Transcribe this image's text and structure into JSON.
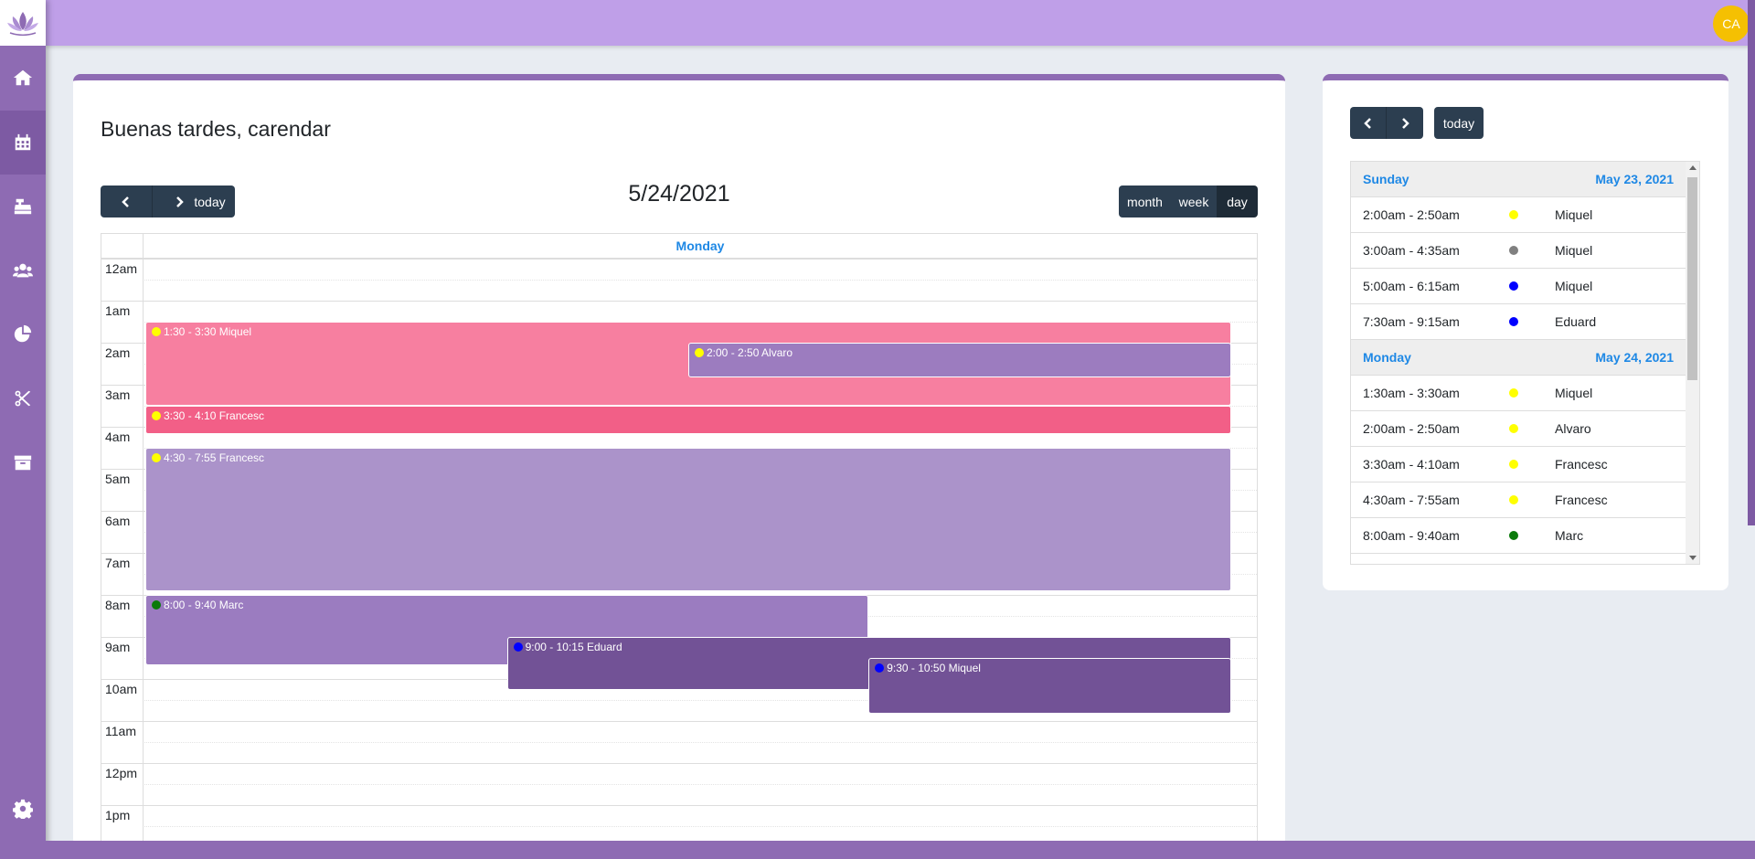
{
  "user": {
    "initials": "CA"
  },
  "nav": {
    "items": [
      {
        "name": "home-icon",
        "active": false
      },
      {
        "name": "calendar-icon",
        "active": true
      },
      {
        "name": "cash-register-icon",
        "active": false
      },
      {
        "name": "users-icon",
        "active": false
      },
      {
        "name": "pie-chart-icon",
        "active": false
      },
      {
        "name": "scissors-icon",
        "active": false
      },
      {
        "name": "box-icon",
        "active": false
      }
    ],
    "settings_icon": "gear-icon"
  },
  "main": {
    "greeting": "Buenas tardes, carendar",
    "today_label": "today",
    "title": "5/24/2021",
    "views": {
      "month": "month",
      "week": "week",
      "day": "day",
      "active": "day"
    },
    "day_header": "Monday",
    "hours": [
      "12am",
      "1am",
      "2am",
      "3am",
      "4am",
      "5am",
      "6am",
      "7am",
      "8am",
      "9am",
      "10am",
      "11am",
      "12pm",
      "1pm"
    ],
    "events": [
      {
        "label": "1:30 - 3:30 Miquel",
        "start": 1.5,
        "end": 3.5,
        "color": "#f77fa0",
        "dot": "#ffff00",
        "col_start": 0,
        "col_end": 1
      },
      {
        "label": "2:00 - 2:50 Alvaro",
        "start": 2.0,
        "end": 2.83,
        "color": "#9c7cbf",
        "dot": "#ffff00",
        "col_start": 0.5,
        "col_end": 1
      },
      {
        "label": "3:30 - 4:10 Francesc",
        "start": 3.5,
        "end": 4.17,
        "color": "#f25f87",
        "dot": "#ffff00",
        "col_start": 0,
        "col_end": 1
      },
      {
        "label": "4:30 - 7:55 Francesc",
        "start": 4.5,
        "end": 7.92,
        "color": "#ab93ca",
        "dot": "#ffff00",
        "col_start": 0,
        "col_end": 1
      },
      {
        "label": "8:00 - 9:40 Marc",
        "start": 8.0,
        "end": 9.67,
        "color": "#9b7cc0",
        "dot": "#0a7a0a",
        "col_start": 0,
        "col_end": 0.666
      },
      {
        "label": "9:00 - 10:15 Eduard",
        "start": 9.0,
        "end": 10.25,
        "color": "#725296",
        "dot": "#0000ff",
        "col_start": 0.333,
        "col_end": 1
      },
      {
        "label": "9:30 - 10:50 Miquel",
        "start": 9.5,
        "end": 10.83,
        "color": "#725296",
        "dot": "#0000ff",
        "col_start": 0.666,
        "col_end": 1
      }
    ]
  },
  "side": {
    "today_label": "today",
    "days": [
      {
        "weekday": "Sunday",
        "date": "May 23, 2021",
        "items": [
          {
            "time": "2:00am - 2:50am",
            "dot": "#ffff00",
            "name": "Miquel"
          },
          {
            "time": "3:00am - 4:35am",
            "dot": "#808080",
            "name": "Miquel"
          },
          {
            "time": "5:00am - 6:15am",
            "dot": "#0000ff",
            "name": "Miquel"
          },
          {
            "time": "7:30am - 9:15am",
            "dot": "#0000ff",
            "name": "Eduard"
          }
        ]
      },
      {
        "weekday": "Monday",
        "date": "May 24, 2021",
        "items": [
          {
            "time": "1:30am - 3:30am",
            "dot": "#ffff00",
            "name": "Miquel"
          },
          {
            "time": "2:00am - 2:50am",
            "dot": "#ffff00",
            "name": "Alvaro"
          },
          {
            "time": "3:30am - 4:10am",
            "dot": "#ffff00",
            "name": "Francesc"
          },
          {
            "time": "4:30am - 7:55am",
            "dot": "#ffff00",
            "name": "Francesc"
          },
          {
            "time": "8:00am - 9:40am",
            "dot": "#0a7a0a",
            "name": "Marc"
          }
        ]
      }
    ]
  }
}
